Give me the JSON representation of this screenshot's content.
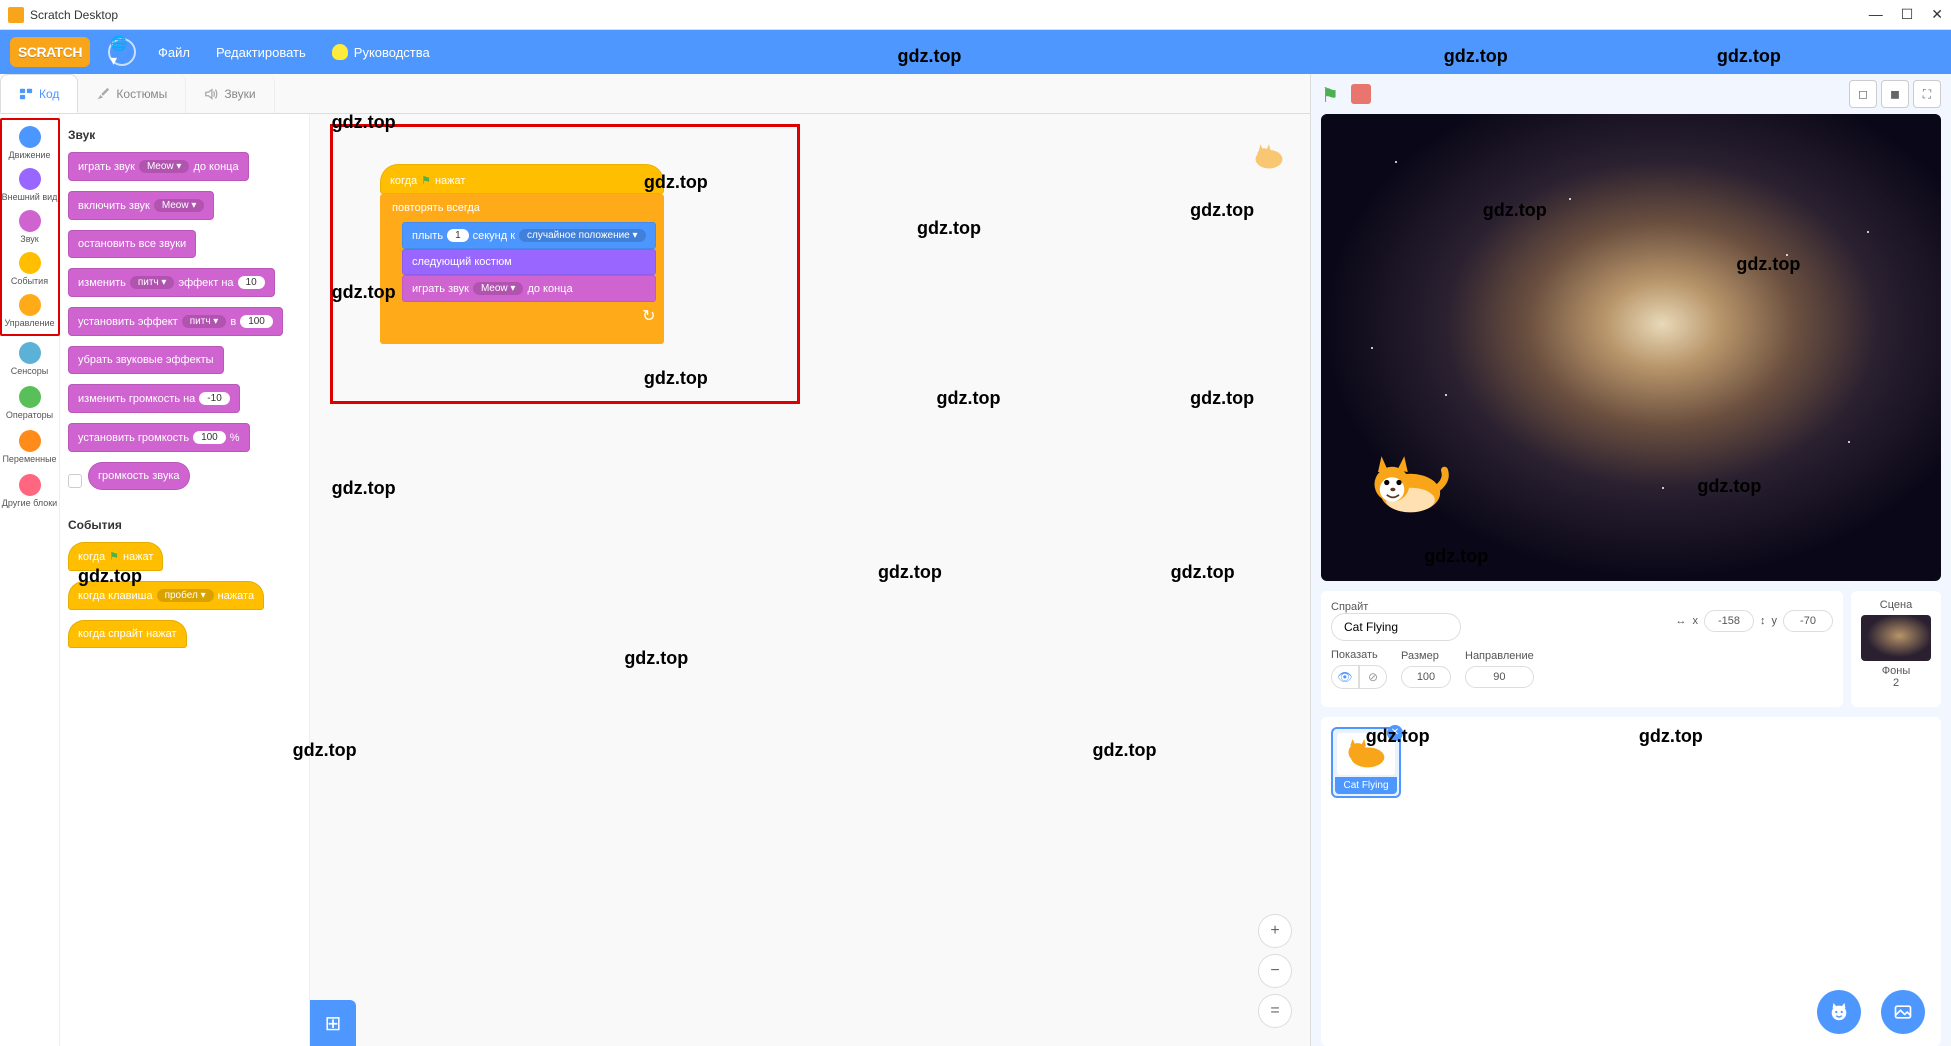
{
  "window": {
    "title": "Scratch Desktop"
  },
  "menubar": {
    "logo": "SCRATCH",
    "file": "Файл",
    "edit": "Редактировать",
    "tutorials": "Руководства"
  },
  "tabs": {
    "code": "Код",
    "costumes": "Костюмы",
    "sounds": "Звуки"
  },
  "categories": {
    "motion": "Движение",
    "looks": "Внешний вид",
    "sound": "Звук",
    "events": "События",
    "control": "Управление",
    "sensing": "Сенсоры",
    "operators": "Операторы",
    "variables": "Переменные",
    "myblocks": "Другие блоки"
  },
  "palette": {
    "sound_header": "Звук",
    "play_until_done": "играть звук",
    "play_until_done_end": "до конца",
    "meow": "Meow",
    "start_sound": "включить звук",
    "stop_all": "остановить все звуки",
    "change_effect": "изменить",
    "pitch": "питч",
    "effect_by": "эффект на",
    "effect_val": "10",
    "set_effect": "установить эффект",
    "set_effect_to": "в",
    "set_effect_val": "100",
    "clear_effects": "убрать звуковые эффекты",
    "change_volume": "изменить громкость на",
    "change_volume_val": "-10",
    "set_volume": "установить громкость",
    "set_volume_val": "100",
    "percent": "%",
    "volume_reporter": "громкость звука",
    "events_header": "События",
    "when_flag": "когда",
    "when_flag_end": "нажат",
    "when_key": "когда клавиша",
    "space": "пробел",
    "pressed": "нажата",
    "when_sprite": "когда спрайт нажат"
  },
  "script": {
    "when_flag": "когда",
    "when_flag_end": "нажат",
    "forever": "повторять всегда",
    "glide": "плыть",
    "glide_secs": "1",
    "glide_secs_to": "секунд к",
    "random_pos": "случайное положение",
    "next_costume": "следующий костюм",
    "play_sound": "играть звук",
    "meow": "Meow",
    "until_done": "до конца"
  },
  "sprite_info": {
    "sprite_label": "Спрайт",
    "name": "Cat Flying",
    "x_label": "x",
    "x": "-158",
    "y_label": "y",
    "y": "-70",
    "show_label": "Показать",
    "size_label": "Размер",
    "size": "100",
    "direction_label": "Направление",
    "direction": "90"
  },
  "stage_info": {
    "label": "Сцена",
    "backdrops_label": "Фоны",
    "backdrops_count": "2"
  },
  "sprite_tile": {
    "name": "Cat Flying"
  },
  "watermarks": [
    "gdz.top"
  ]
}
